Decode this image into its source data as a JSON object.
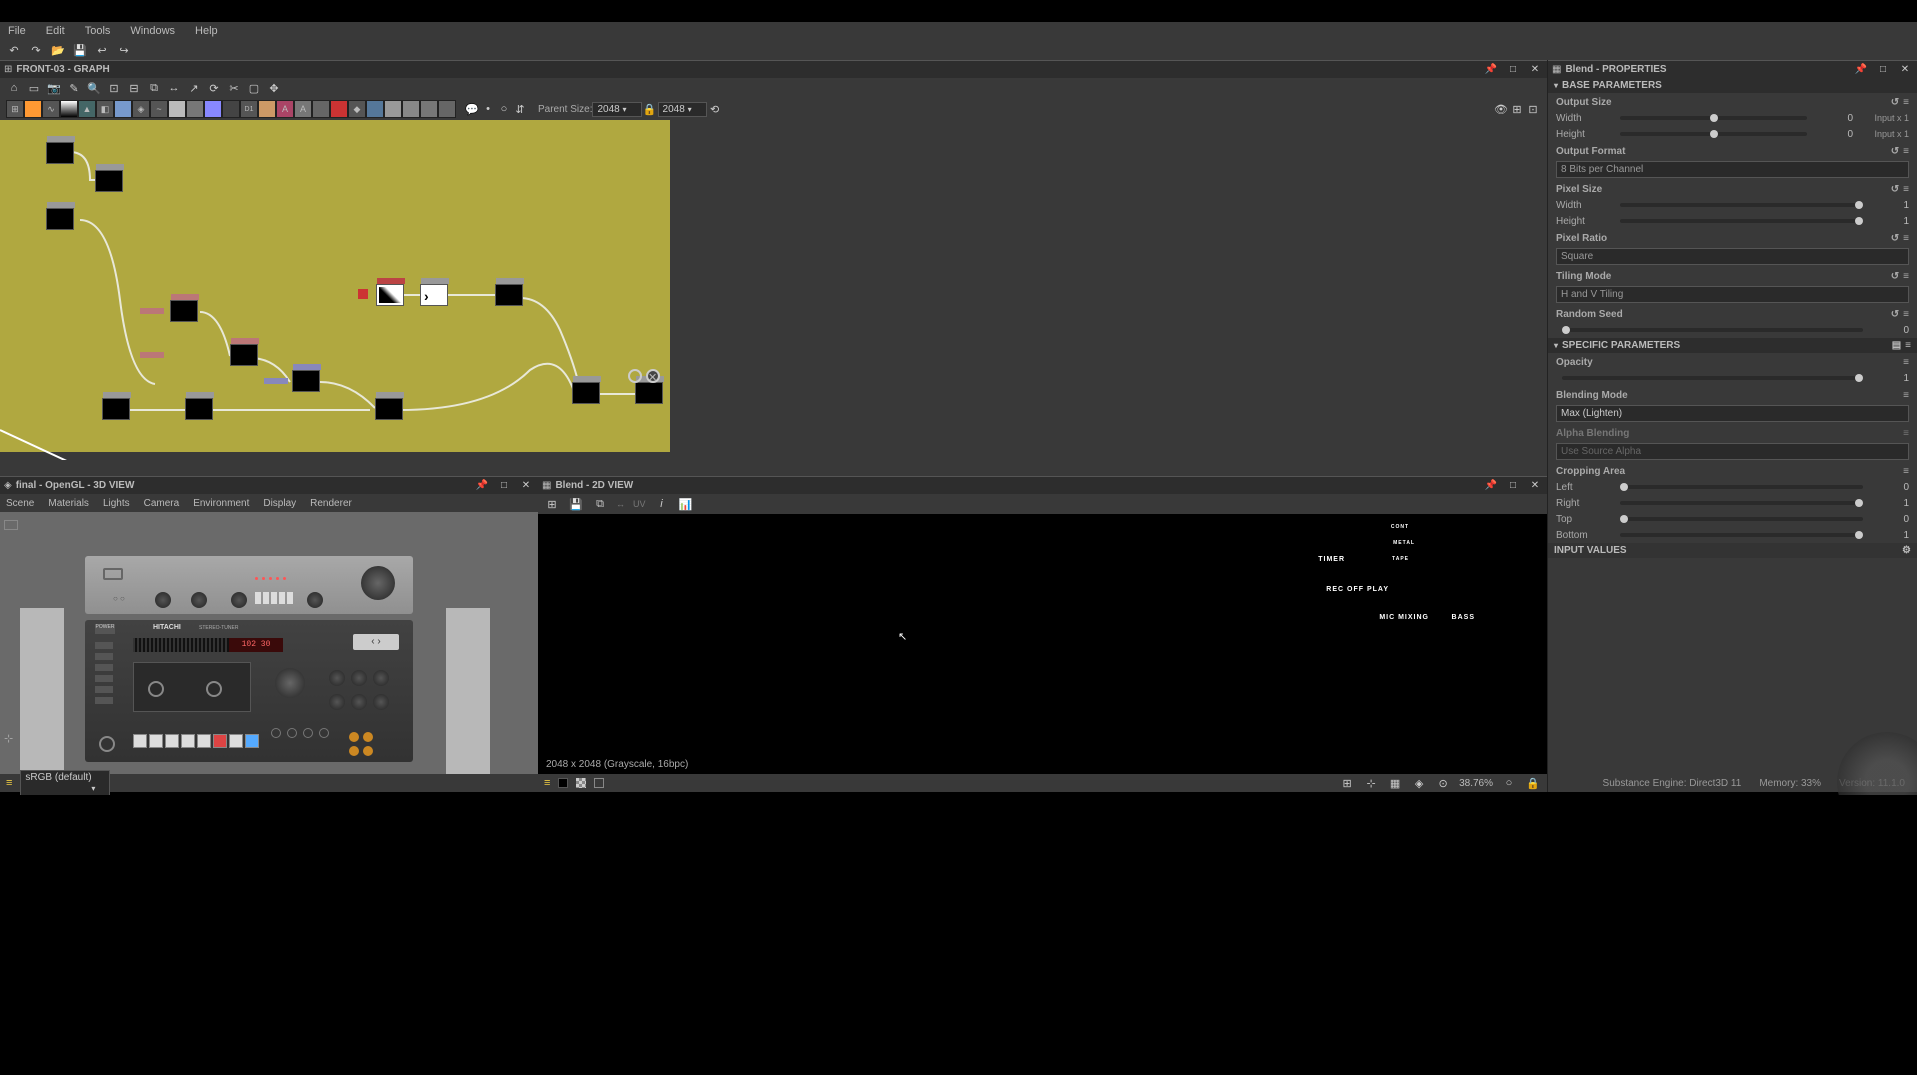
{
  "menu": {
    "file": "File",
    "edit": "Edit",
    "tools": "Tools",
    "windows": "Windows",
    "help": "Help"
  },
  "graph": {
    "title": "FRONT-03 - GRAPH",
    "parent_size_label": "Parent Size:",
    "parent_size_value": "2048",
    "size_value": "2048"
  },
  "view3d": {
    "title": "final - OpenGL - 3D VIEW",
    "menus": {
      "scene": "Scene",
      "materials": "Materials",
      "lights": "Lights",
      "camera": "Camera",
      "environment": "Environment",
      "display": "Display",
      "renderer": "Renderer"
    },
    "colorspace": "sRGB (default)",
    "brand": "HITACHI",
    "model": "STEREO-TUNER"
  },
  "view2d": {
    "title": "Blend - 2D VIEW",
    "status": "2048 x 2048 (Grayscale, 16bpc)",
    "zoom": "38.76%",
    "labels": {
      "timer": "TIMER",
      "rec_off_play": "REC OFF PLAY",
      "mic_mixing": "MIC MIXING",
      "bass": "BASS",
      "cont": "CONT",
      "metal": "METAL",
      "tape": "TAPE"
    }
  },
  "properties": {
    "title": "Blend - PROPERTIES",
    "sections": {
      "base": "BASE PARAMETERS",
      "specific": "SPECIFIC PARAMETERS",
      "input_values": "INPUT VALUES"
    },
    "output_size_label": "Output Size",
    "width_label": "Width",
    "height_label": "Height",
    "width_val": "0",
    "height_val": "0",
    "width_extra": "Input x 1",
    "height_extra": "Input x 1",
    "output_format_label": "Output Format",
    "output_format_value": "8 Bits per Channel",
    "pixel_size_label": "Pixel Size",
    "pixel_size_w": "1",
    "pixel_size_h": "1",
    "pixel_ratio_label": "Pixel Ratio",
    "pixel_ratio_value": "Square",
    "tiling_mode_label": "Tiling Mode",
    "tiling_mode_value": "H and V Tiling",
    "random_seed_label": "Random Seed",
    "random_seed_val": "0",
    "opacity_label": "Opacity",
    "opacity_val": "1",
    "blending_mode_label": "Blending Mode",
    "blending_mode_value": "Max (Lighten)",
    "alpha_blending_label": "Alpha Blending",
    "alpha_blending_value": "Use Source Alpha",
    "cropping_area_label": "Cropping Area",
    "left_label": "Left",
    "right_label": "Right",
    "top_label": "Top",
    "bottom_label": "Bottom",
    "left_val": "0",
    "right_val": "1",
    "top_val": "0",
    "bottom_val": "1"
  },
  "footer": {
    "engine": "Substance Engine: Direct3D 11",
    "memory": "Memory: 33%",
    "version": "Version: 11.1.0"
  }
}
